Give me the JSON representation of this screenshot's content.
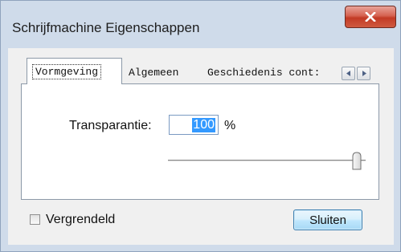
{
  "window": {
    "title": "Schrijfmachine Eigenschappen"
  },
  "tabs": {
    "items": [
      {
        "label": "Vormgeving",
        "active": true
      },
      {
        "label": "Algemeen",
        "active": false
      },
      {
        "label": "Geschiedenis cont:",
        "active": false
      }
    ],
    "scroll_left_icon": "arrow-left",
    "scroll_right_icon": "arrow-right"
  },
  "transparency": {
    "label": "Transparantie:",
    "value": "100",
    "unit": "%",
    "slider_value_percent": 100
  },
  "lock": {
    "label": "Vergrendeld",
    "checked": false
  },
  "footer": {
    "close_label": "Sluiten"
  },
  "colors": {
    "close_button_red": "#c23a25",
    "selection_blue": "#3399ff"
  }
}
